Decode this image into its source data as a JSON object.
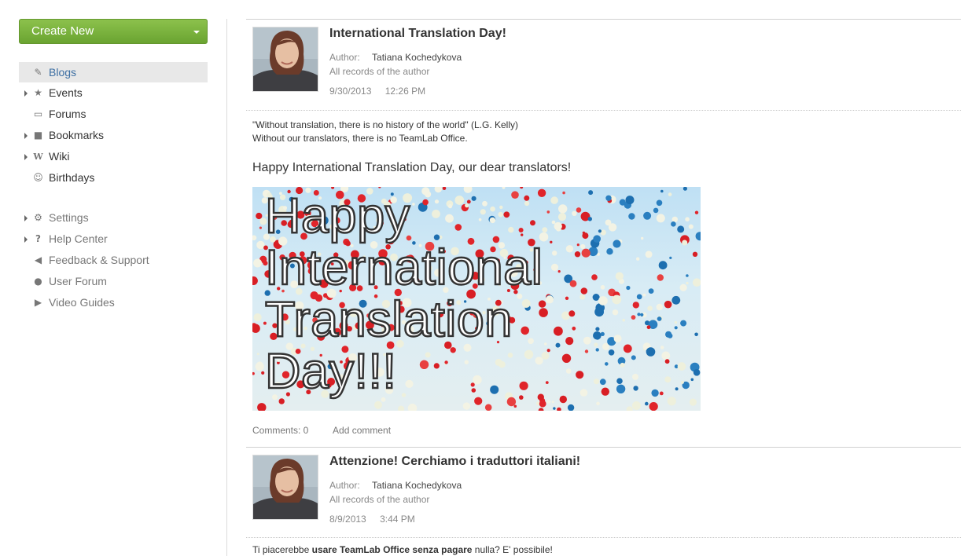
{
  "sidebar": {
    "create_label": "Create New",
    "menu": [
      {
        "label": "Blogs",
        "icon": "edit-icon",
        "active": true,
        "expandable": false
      },
      {
        "label": "Events",
        "icon": "pin-icon",
        "active": false,
        "expandable": true
      },
      {
        "label": "Forums",
        "icon": "speech-bubble-icon",
        "active": false,
        "expandable": false
      },
      {
        "label": "Bookmarks",
        "icon": "bookmark-icon",
        "active": false,
        "expandable": true
      },
      {
        "label": "Wiki",
        "icon": "wiki-icon",
        "active": false,
        "expandable": true
      },
      {
        "label": "Birthdays",
        "icon": "people-icon",
        "active": false,
        "expandable": false
      }
    ],
    "secondary": [
      {
        "label": "Settings",
        "icon": "gear-icon",
        "expandable": true
      },
      {
        "label": "Help Center",
        "icon": "question-icon",
        "expandable": true
      },
      {
        "label": "Feedback & Support",
        "icon": "megaphone-icon",
        "expandable": false
      },
      {
        "label": "User Forum",
        "icon": "chat-icon",
        "expandable": false
      },
      {
        "label": "Video Guides",
        "icon": "play-icon",
        "expandable": false
      }
    ]
  },
  "posts": [
    {
      "title": "International Translation Day!",
      "author_label": "Author:",
      "author": "Tatiana Kochedykova",
      "records_link": "All records of the author",
      "date": "9/30/2013",
      "time": "12:26 PM",
      "quote_line1": "\"Without translation, there is no history of the world\" (L.G. Kelly)",
      "quote_line2": "Without our translators, there is no TeamLab Office.",
      "greeting": "Happy International Translation Day, our dear translators!",
      "banner_lines": [
        "Happy",
        "International",
        "Translation",
        "Day!!!"
      ],
      "comments": "Comments: 0",
      "add_comment": "Add comment"
    },
    {
      "title": "Attenzione! Cerchiamo i traduttori italiani!",
      "author_label": "Author:",
      "author": "Tatiana Kochedykova",
      "records_link": "All records of the author",
      "date": "8/9/2013",
      "time": "3:44 PM",
      "teaser_pre": "Ti piacerebbe ",
      "teaser_bold": "usare TeamLab Office senza pagare",
      "teaser_post": " nulla? E' possibile!"
    }
  ],
  "colors": {
    "create_button": "#7ab23d",
    "active_link": "#3d6fa3",
    "active_bg": "#e8e8e8"
  }
}
